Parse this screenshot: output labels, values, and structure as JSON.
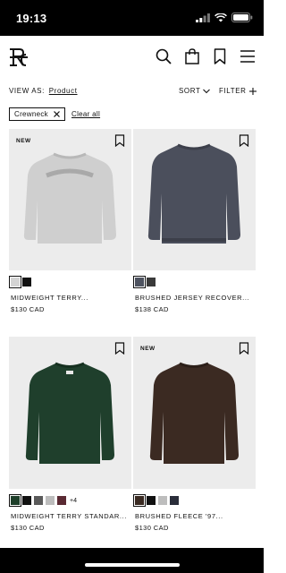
{
  "status": {
    "time": "19:13"
  },
  "header": {
    "logo": "rc-monogram-logo",
    "icons": [
      "search-icon",
      "shopping-bag-icon",
      "bookmark-icon",
      "menu-icon"
    ]
  },
  "toolbar": {
    "view_as_label": "VIEW AS:",
    "view_as_value": "Product",
    "sort_label": "SORT",
    "filter_label": "FILTER"
  },
  "active_filters": {
    "chip_label": "Crewneck",
    "clear_all": "Clear all"
  },
  "products": [
    {
      "badge": "NEW",
      "name": "MIDWEIGHT TERRY...",
      "price": "$130 CAD",
      "garment_color": "#cfcfcf",
      "swatches": [
        "#d4d4d4",
        "#111111"
      ],
      "more": ""
    },
    {
      "badge": "",
      "name": "BRUSHED JERSEY RECOVER...",
      "price": "$138 CAD",
      "garment_color": "#4b4f5c",
      "swatches": [
        "#4e5360",
        "#3a3a3a"
      ],
      "more": ""
    },
    {
      "badge": "",
      "name": "MIDWEIGHT TERRY STANDAR...",
      "price": "$130 CAD",
      "garment_color": "#1f3f2c",
      "swatches": [
        "#1e3f2a",
        "#111111",
        "#5a5a5a",
        "#bdbdbd",
        "#5a2a33"
      ],
      "more": "+4"
    },
    {
      "badge": "NEW",
      "name": "BRUSHED FLEECE '97...",
      "price": "$130 CAD",
      "garment_color": "#3b2a22",
      "swatches": [
        "#3a2a22",
        "#111111",
        "#bdbdbd",
        "#2a2d3a"
      ],
      "more": ""
    }
  ]
}
